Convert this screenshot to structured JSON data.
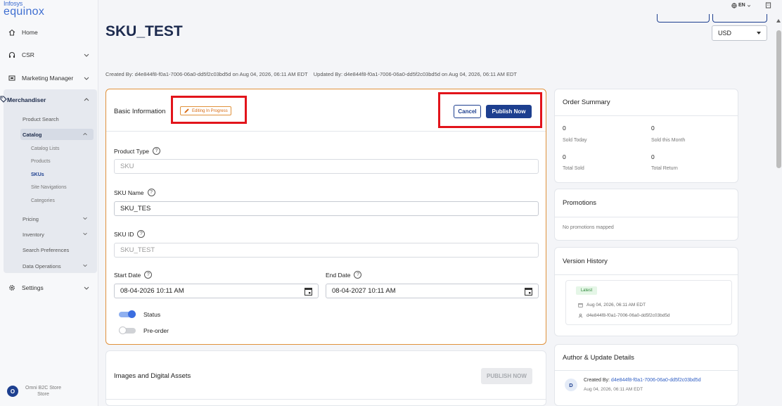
{
  "app": {
    "logo_line1": "Infosys",
    "logo_line2": "equinox",
    "language": "EN",
    "currency": "USD"
  },
  "sidebar": {
    "items": [
      {
        "label": "Home",
        "icon": "home-icon"
      },
      {
        "label": "CSR",
        "icon": "headset-icon"
      },
      {
        "label": "Marketing Manager",
        "icon": "megaphone-icon"
      },
      {
        "label": "Merchandiser",
        "icon": "tag-icon"
      },
      {
        "label": "Settings",
        "icon": "gear-icon"
      }
    ],
    "merch_sub": {
      "product_search": "Product Search",
      "catalog": "Catalog",
      "catalog_lists": "Catalog Lists",
      "products": "Products",
      "skus": "SKUs",
      "site_navigations": "Site Navigations",
      "categories": "Categories",
      "pricing": "Pricing",
      "inventory": "Inventory",
      "search_preferences": "Search Preferences",
      "data_operations": "Data Operations"
    },
    "store": {
      "avatar": "O",
      "name": "Omni B2C Store",
      "type": "Store"
    }
  },
  "page": {
    "title": "SKU_TEST",
    "meta": "Created By: d4e844f8-f0a1-7006-06a0-dd5f2c03bd5d on Aug 04, 2026, 06:11 AM EDT    Updated By: d4e844f8-f0a1-7006-06a0-dd5f2c03bd5d on Aug 04, 2026, 06:11 AM EDT"
  },
  "basic_info": {
    "title": "Basic Information",
    "badge": "Editing In Progress",
    "cancel": "Cancel",
    "publish": "Publish Now",
    "product_type_label": "Product Type",
    "product_type_value": "SKU",
    "sku_name_label": "SKU Name",
    "sku_name_value": "SKU_TES",
    "sku_id_label": "SKU ID",
    "sku_id_value": "SKU_TEST",
    "start_date_label": "Start Date",
    "start_date_value": "08-04-2026 10:11 AM",
    "end_date_label": "End Date",
    "end_date_value": "08-04-2027 10:11 AM",
    "status_label": "Status",
    "status_on": true,
    "preorder_label": "Pre-order",
    "preorder_on": false
  },
  "images_card": {
    "title": "Images and Digital Assets",
    "publish": "PUBLISH NOW"
  },
  "order_summary": {
    "title": "Order Summary",
    "sold_today": "0",
    "sold_today_label": "Sold Today",
    "sold_month": "0",
    "sold_month_label": "Sold this Month",
    "total_sold": "0",
    "total_sold_label": "Total Sold",
    "total_return": "0",
    "total_return_label": "Total Return"
  },
  "promotions": {
    "title": "Promotions",
    "empty": "No promotions mapped"
  },
  "version_history": {
    "title": "Version History",
    "badge": "Latest",
    "date": "Aug 04, 2026, 06:11 AM EDT",
    "user": "d4e844f8-f0a1-7006-06a0-dd5f2c03bd5d"
  },
  "author": {
    "title": "Author & Update Details",
    "avatar": "D",
    "created_prefix": "Created By:",
    "created_by": "d4e844f8-f0a1-7006-06a0-dd5f2c03bd5d",
    "created_on": "Aug 04, 2026, 06:11 AM EDT"
  },
  "colors": {
    "brand": "#1d3f8f",
    "accent_orange": "#e0913b",
    "highlight_red": "#e2141b",
    "toggle_on": "#3b6ee0"
  }
}
